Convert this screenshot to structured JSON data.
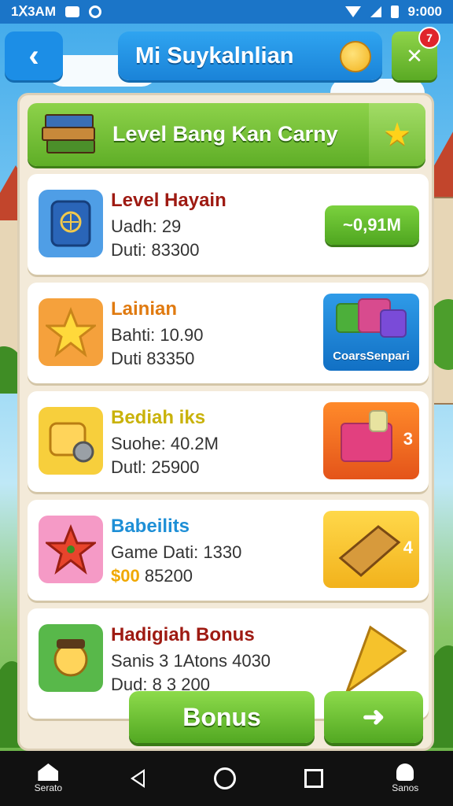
{
  "status_bar": {
    "time_left": "1Ⅹ3AM",
    "time_right": "9:000"
  },
  "header": {
    "back_icon": "chevron-left-icon",
    "title": "Mi Suykalnlian",
    "gift_badge": "7"
  },
  "banner": {
    "title": "Level Bang Kan Carny"
  },
  "cards": [
    {
      "name": "Level Hayain",
      "name_color": "#9e1a12",
      "line1": "Uadh: 29",
      "line2": "Duti: 83300",
      "icon": "passport-icon",
      "icon_bg": "#4f9ee6",
      "action_label": "~0,91M"
    },
    {
      "name": "Lainian",
      "name_color": "#e07a10",
      "line1": "Bahti:  10.90",
      "line2": "Duti  83350",
      "icon": "star-icon",
      "icon_bg": "#f5a13c",
      "reward_label": "CoarsSenpari"
    },
    {
      "name": "Bediah iks",
      "name_color": "#c9b20a",
      "line1": "Suohe: 40.2M",
      "line2": "Dutl: 25900",
      "icon": "ticket-icon",
      "icon_bg": "#f7cf3c",
      "reward_count": "3"
    },
    {
      "name": "Babeilits",
      "name_color": "#1e8fd6",
      "line1": "Game Dati: 1330",
      "line2_accent": "$00",
      "line2": " 85200",
      "icon": "tomato-star-icon",
      "icon_bg": "#f59ac6",
      "reward_count": "4"
    },
    {
      "name": "Hadigiah Bonus",
      "name_color": "#9e1a12",
      "line1": "Sanis 3 1Atons 4030",
      "line2": "Dud: 8 3 200",
      "icon": "farmer-icon",
      "icon_bg": "#58b84a"
    }
  ],
  "buttons": {
    "bonus": "Bonus",
    "next_icon": "arrow-right-icon"
  },
  "nav": {
    "left_label": "Serato",
    "right_label": "Sanos"
  }
}
